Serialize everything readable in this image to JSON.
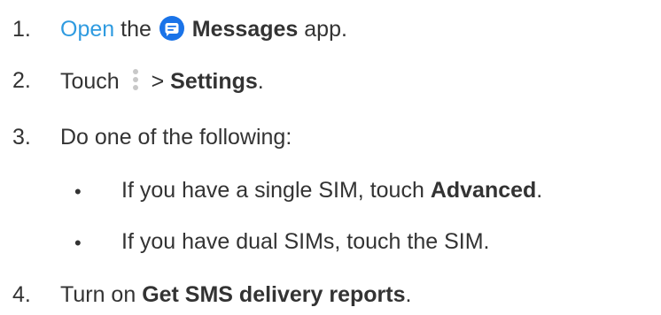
{
  "steps": [
    {
      "num": "1.",
      "link": "Open",
      "t1": " the ",
      "bold": "Messages",
      "t2": " app.",
      "icon": "messages-app-icon"
    },
    {
      "num": "2.",
      "t1": "Touch ",
      "t2": " > ",
      "bold": "Settings",
      "t3": ".",
      "icon": "more-options-icon"
    },
    {
      "num": "3.",
      "text": "Do one of the following:"
    },
    {
      "num": "4.",
      "t1": "Turn on ",
      "bold": "Get SMS delivery reports",
      "t2": "."
    }
  ],
  "bullets": [
    {
      "mark": "•",
      "t1": "If you have a single SIM, touch ",
      "bold": "Advanced",
      "t2": "."
    },
    {
      "mark": "•",
      "text": "If you have dual SIMs, touch the SIM."
    }
  ],
  "colors": {
    "link": "#2f9be0",
    "icon_blue": "#1a73e8",
    "text": "#333333",
    "menu_dots": "#c8c8c8"
  }
}
